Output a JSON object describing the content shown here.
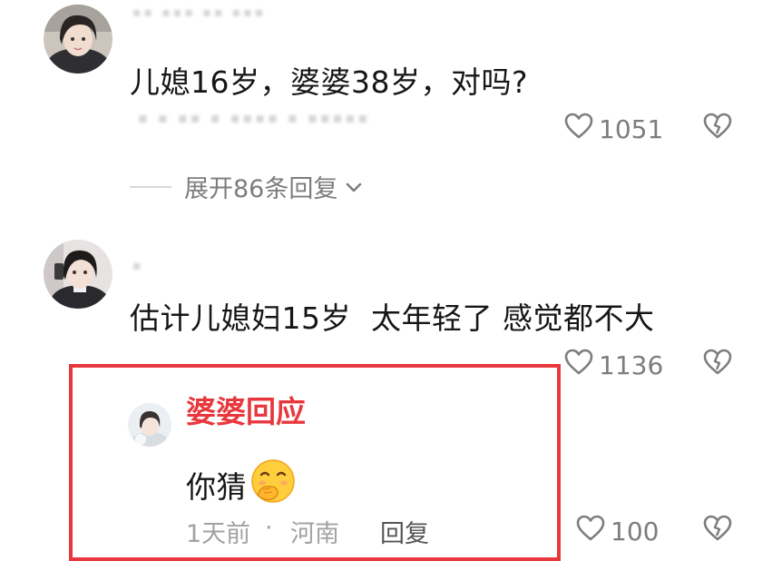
{
  "comments": [
    {
      "text": "儿媳16岁，婆婆38岁，对吗?",
      "likes": "1051",
      "expand_label": "展开86条回复"
    },
    {
      "text": "估计儿媳妇15岁  太年轻了 感觉都不大",
      "likes": "1136",
      "reply": {
        "author": "婆婆回应",
        "text": "你猜",
        "emoji": "smirk-cover-mouth-emoji",
        "time": "1天前",
        "separator": "·",
        "location": "河南",
        "reply_label": "回复",
        "likes": "100"
      }
    }
  ],
  "icons": {
    "like": "heart-outline-icon",
    "dislike": "broken-heart-icon",
    "expand": "chevron-down-icon"
  },
  "colors": {
    "highlight": "#e8383d",
    "muted_text": "#7d7d7d",
    "light_text": "#a2a2a2",
    "main_text": "#161616"
  }
}
